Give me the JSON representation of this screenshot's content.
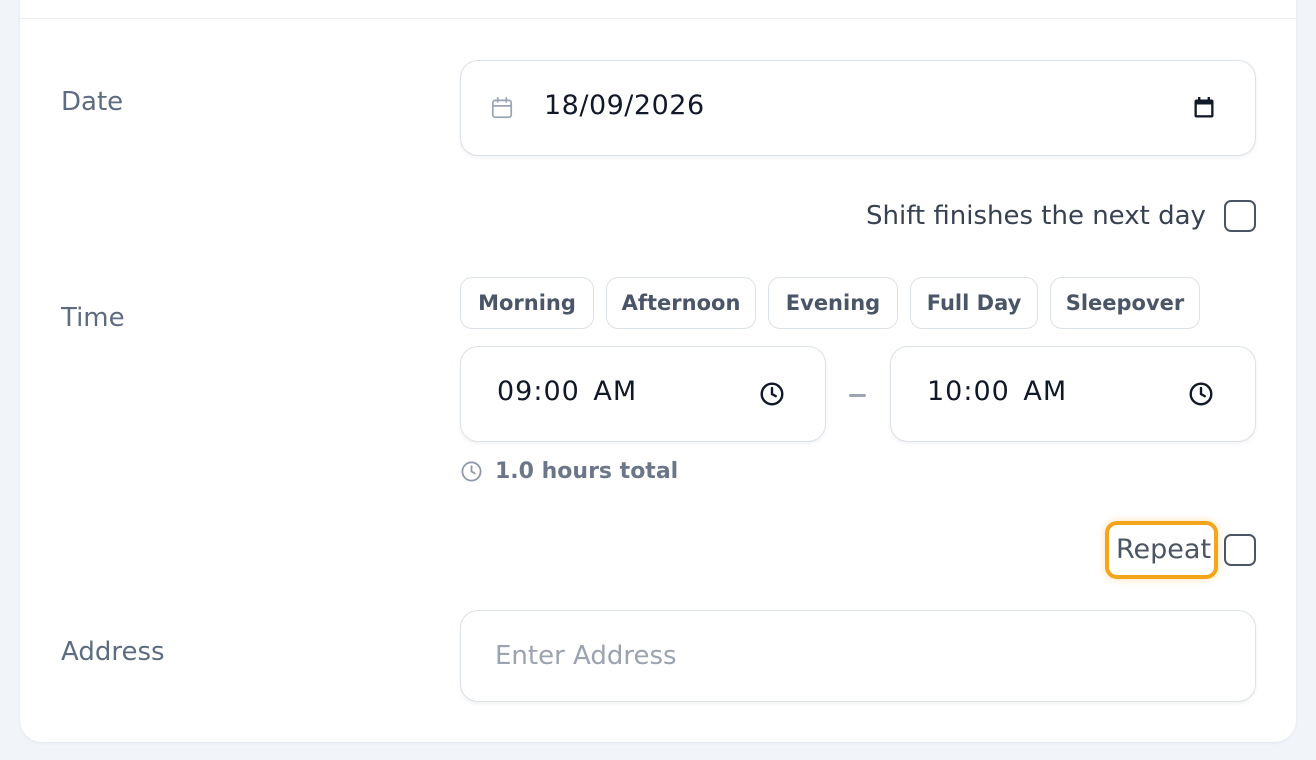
{
  "form": {
    "date": {
      "label": "Date",
      "value": "18/09/2026",
      "icon": "calendar-icon",
      "picker_icon": "calendar-picker-icon"
    },
    "next_day": {
      "label": "Shift finishes the next day",
      "checked": false
    },
    "time": {
      "label": "Time",
      "presets": [
        "Morning",
        "Afternoon",
        "Evening",
        "Full Day",
        "Sleepover"
      ],
      "start": "09:00 AM",
      "end": "10:00 AM",
      "separator": "–",
      "total": "1.0 hours total",
      "icon": "clock-icon"
    },
    "repeat": {
      "label": "Repeat",
      "checked": false
    },
    "address": {
      "label": "Address",
      "placeholder": "Enter Address",
      "value": ""
    }
  },
  "colors": {
    "background": "#f1f4f8",
    "card": "#ffffff",
    "label": "#5d6c80",
    "text": "#111827",
    "border": "#dbe1e8",
    "highlight": "#f5a51c"
  }
}
